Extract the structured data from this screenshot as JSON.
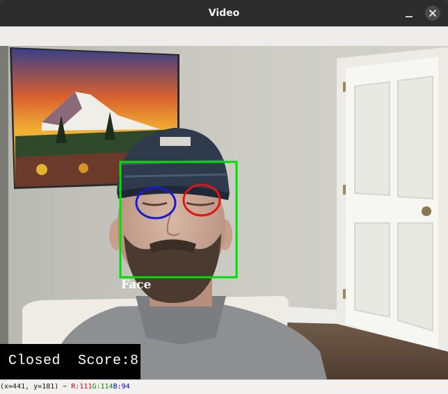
{
  "window": {
    "title": "Video",
    "min_icon": "minimize-icon",
    "close_icon": "close-icon"
  },
  "video": {
    "face_label": "Face",
    "status_text": "Closed",
    "score_text": "Score:8",
    "colors": {
      "face_box": "#00e000",
      "left_eye": "#1a1ad6",
      "right_eye": "#e01414"
    }
  },
  "statusbar": {
    "coords": "(x=441, y=181) ~",
    "r": "R:111",
    "g": "G:114",
    "b": "B:94"
  }
}
